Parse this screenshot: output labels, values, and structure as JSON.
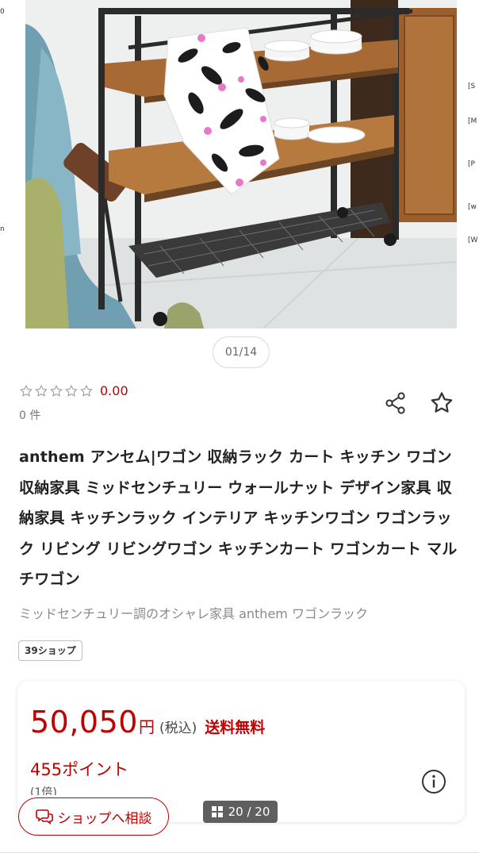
{
  "gallery": {
    "left_edge_texts": [
      "0",
      "n"
    ],
    "right_edge_texts": [
      "[S",
      "[M",
      "[P",
      "[w",
      "[W"
    ],
    "pager": "01/14"
  },
  "rating": {
    "stars_filled": 0,
    "stars_total": 5,
    "value": "0.00",
    "review_count": "0 件"
  },
  "product": {
    "title": "anthem アンセム|ワゴン 収納ラック カート キッチン ワゴン 収納家具 ミッドセンチュリー ウォールナット デザイン家具 収納家具 キッチンラック インテリア キッチンワゴン ワゴンラック リビング リビングワゴン キッチンカート ワゴンカート マルチワゴン",
    "subtitle": "ミッドセンチュリー調のオシャレ家具 anthem ワゴンラック",
    "shop_tag": "39ショップ"
  },
  "price": {
    "amount": "50,050",
    "currency": "円",
    "tax_note": "(税込)",
    "shipping": "送料無料",
    "points": "455ポイント",
    "points_rate": "(1倍)"
  },
  "actions": {
    "consult_label": "ショップへ相談",
    "photo_counter": "20 / 20"
  },
  "colors": {
    "accent_red": "#bf0000",
    "wood": "#a86a35",
    "frame": "#2b2b2b"
  },
  "icons": [
    "share-icon",
    "star-outline-icon",
    "info-icon",
    "chat-icon",
    "grid-icon"
  ]
}
